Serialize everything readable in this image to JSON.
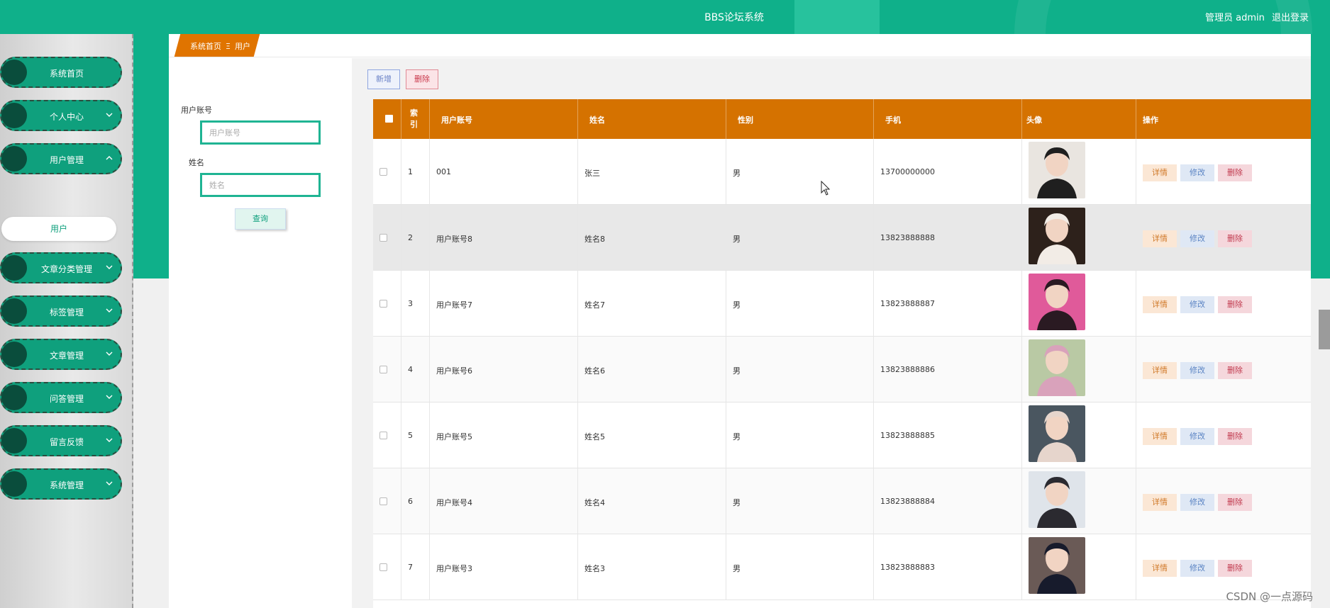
{
  "header": {
    "title": "BBS论坛系统",
    "user_label": "管理员 admin",
    "logout_label": "退出登录",
    "accent_color": "#0fb08a"
  },
  "sidebar": {
    "items": [
      {
        "label": "系统首页",
        "icon": "circle-dot-icon"
      },
      {
        "label": "个人中心",
        "icon": "chevron-down-icon"
      },
      {
        "label": "用户管理",
        "icon": "chevron-up-icon"
      },
      {
        "label": "文章分类管理",
        "icon": "chevron-down-icon"
      },
      {
        "label": "标签管理",
        "icon": "chevron-down-icon"
      },
      {
        "label": "文章管理",
        "icon": "chevron-down-icon"
      },
      {
        "label": "问答管理",
        "icon": "chevron-down-icon"
      },
      {
        "label": "留言反馈",
        "icon": "chevron-down-icon"
      },
      {
        "label": "系统管理",
        "icon": "chevron-down-icon"
      }
    ],
    "subitem": "用户"
  },
  "breadcrumb": {
    "home": "系统首页",
    "separator": "Ξ",
    "current": "用户"
  },
  "search": {
    "account_label": "用户账号",
    "account_placeholder": "用户账号",
    "name_label": "姓名",
    "name_placeholder": "姓名",
    "query_label": "查询"
  },
  "toolbar": {
    "add_label": "新增",
    "delete_label": "删除"
  },
  "table": {
    "header_color": "#d57200",
    "columns": [
      "索引",
      "用户账号",
      "姓名",
      "性别",
      "手机",
      "头像",
      "操作"
    ],
    "rows": [
      {
        "index": "1",
        "account": "001",
        "name": "张三",
        "gender": "男",
        "phone": "13700000000"
      },
      {
        "index": "2",
        "account": "用户账号8",
        "name": "姓名8",
        "gender": "男",
        "phone": "13823888888"
      },
      {
        "index": "3",
        "account": "用户账号7",
        "name": "姓名7",
        "gender": "男",
        "phone": "13823888887"
      },
      {
        "index": "4",
        "account": "用户账号6",
        "name": "姓名6",
        "gender": "男",
        "phone": "13823888886"
      },
      {
        "index": "5",
        "account": "用户账号5",
        "name": "姓名5",
        "gender": "男",
        "phone": "13823888885"
      },
      {
        "index": "6",
        "account": "用户账号4",
        "name": "姓名4",
        "gender": "男",
        "phone": "13823888884"
      },
      {
        "index": "7",
        "account": "用户账号3",
        "name": "姓名3",
        "gender": "男",
        "phone": "13823888883"
      }
    ],
    "actions": {
      "detail": "详情",
      "edit": "修改",
      "delete": "删除"
    }
  },
  "watermark": "CSDN @一点源码"
}
